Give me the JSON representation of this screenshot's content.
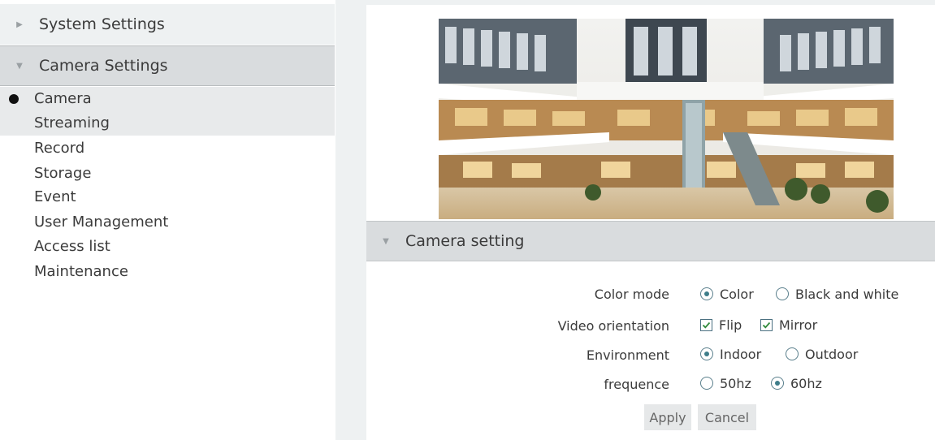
{
  "sidebar": {
    "sections": [
      {
        "label": "System Settings",
        "expanded": false
      },
      {
        "label": "Camera Settings",
        "expanded": true
      }
    ],
    "items": [
      {
        "label": "Camera",
        "selected": true
      },
      {
        "label": "Streaming"
      },
      {
        "label": "Record"
      },
      {
        "label": "Storage"
      },
      {
        "label": "Event"
      },
      {
        "label": "User Management"
      },
      {
        "label": "Access list"
      },
      {
        "label": "Maintenance"
      }
    ]
  },
  "panel": {
    "title": "Camera setting",
    "rows": [
      {
        "label": "Color mode",
        "options": [
          {
            "label": "Color",
            "type": "radio",
            "checked": true
          },
          {
            "label": "Black and white",
            "type": "radio",
            "checked": false
          }
        ]
      },
      {
        "label": "Video orientation",
        "options": [
          {
            "label": "Flip",
            "type": "checkbox",
            "checked": true
          },
          {
            "label": "Mirror",
            "type": "checkbox",
            "checked": true
          }
        ]
      },
      {
        "label": "Environment",
        "options": [
          {
            "label": "Indoor",
            "type": "radio",
            "checked": true
          },
          {
            "label": "Outdoor",
            "type": "radio",
            "checked": false
          }
        ]
      },
      {
        "label": "frequence",
        "options": [
          {
            "label": "50hz",
            "type": "radio",
            "checked": false
          },
          {
            "label": "60hz",
            "type": "radio",
            "checked": true
          }
        ]
      }
    ],
    "apply_label": "Apply",
    "cancel_label": "Cancel"
  },
  "icons": {
    "collapsed": "chevron-right-icon",
    "expanded": "chevron-down-icon",
    "selected": "bullet-icon",
    "checkbox": "checkbox-checked-icon"
  },
  "colors": {
    "sidebar_header_bg": "#eef1f2",
    "active_header_bg": "#d9dcde",
    "selected_item_bg": "#e8eaeb",
    "control_accent": "#3e7d8a"
  }
}
